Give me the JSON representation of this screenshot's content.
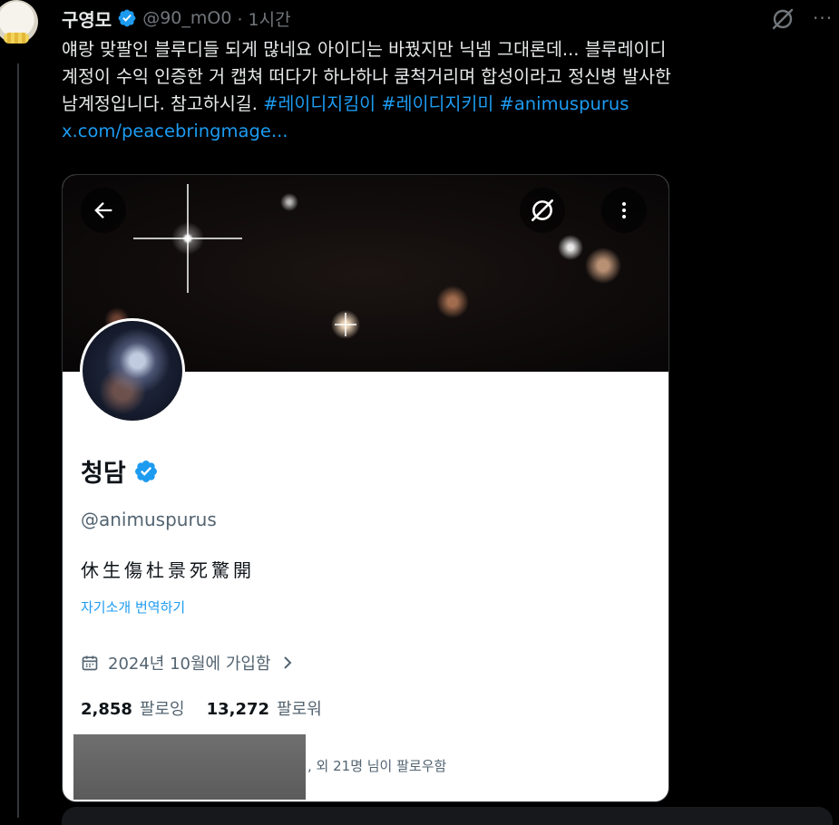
{
  "tweet": {
    "author_name": "구영모",
    "author_handle": "@90_mO0",
    "time": "· 1시간",
    "lines": [
      "얘랑 맞팔인 블루디들 되게 많네요 아이디는 바꿨지만 닉넴 그대론데... 블루레이디",
      "계정이 수익 인증한 거 캡쳐 떠다가 하나하나 쿰척거리며 합성이라고 정신병 발사한"
    ],
    "line3_text": "남계정입니다. 참고하시길.",
    "hashtags": [
      "#레이디지킴이",
      "#레이디지키미",
      "#animuspurus"
    ],
    "link": "x.com/peacebringmage..."
  },
  "profile_card": {
    "name": "청담",
    "handle": "@animuspurus",
    "bio": "休生傷杜景死驚開",
    "translate_label": "자기소개 번역하기",
    "joined": "2024년 10월에 가입함",
    "following_count": "2,858",
    "following_label": "팔로잉",
    "followers_count": "13,272",
    "followers_label": "팔로워",
    "followed_by": ", 외 21명 님이 팔로우함"
  },
  "colors": {
    "accent": "#1d9bf0",
    "background": "#000000",
    "muted": "#71767b"
  },
  "icons": {
    "verified": "verified-badge-icon",
    "grok": "grok-icon",
    "more": "more-icon",
    "back": "back-arrow-icon",
    "calendar": "calendar-icon"
  }
}
